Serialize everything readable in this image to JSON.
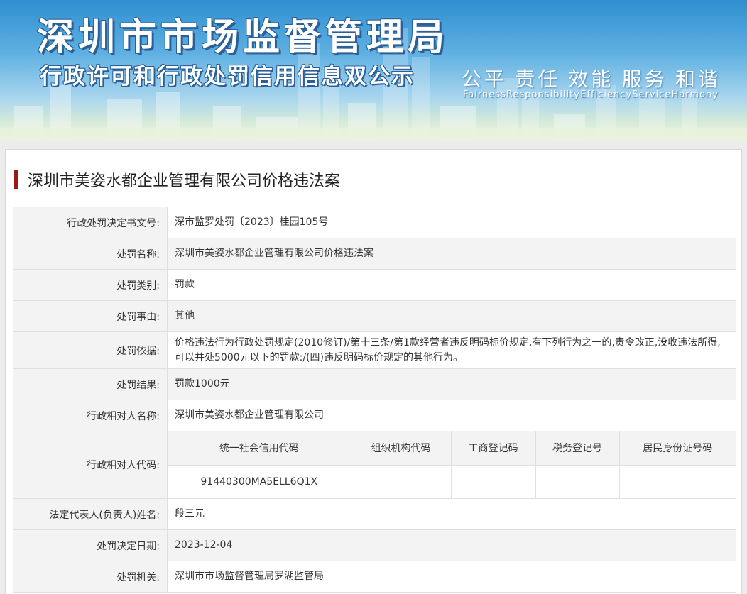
{
  "banner": {
    "title": "深圳市市场监督管理局",
    "subtitle": "行政许可和行政处罚信用信息双公示",
    "slogan": [
      "公平",
      "责任",
      "效能",
      "服务",
      "和谐"
    ],
    "slogan_en": [
      "Fairness",
      "Responsibility",
      "Efficiency",
      "Service",
      "Harmony"
    ]
  },
  "case_title": "深圳市美姿水都企业管理有限公司价格违法案",
  "rows": {
    "decision_no": {
      "label": "行政处罚决定书文号:",
      "value": "深市监罗处罚〔2023〕桂园105号"
    },
    "penalty_name": {
      "label": "处罚名称:",
      "value": "深圳市美姿水都企业管理有限公司价格违法案"
    },
    "penalty_type": {
      "label": "处罚类别:",
      "value": "罚款"
    },
    "penalty_reason": {
      "label": "处罚事由:",
      "value": "其他"
    },
    "penalty_basis": {
      "label": "处罚依据:",
      "value": "价格违法行为行政处罚规定(2010修订)/第十三条/第1款经营者违反明码标价规定,有下列行为之一的,责令改正,没收违法所得,可以并处5000元以下的罚款:/(四)违反明码标价规定的其他行为。"
    },
    "penalty_result": {
      "label": "处罚结果:",
      "value": "罚款1000元"
    },
    "party_name": {
      "label": "行政相对人名称:",
      "value": "深圳市美姿水都企业管理有限公司"
    },
    "party_code": {
      "label": "行政相对人代码:",
      "headers": [
        "统一社会信用代码",
        "组织机构代码",
        "工商登记码",
        "税务登记号",
        "居民身份证号码"
      ],
      "values": [
        "91440300MA5ELL6Q1X",
        "",
        "",
        "",
        ""
      ]
    },
    "legal_rep": {
      "label": "法定代表人(负责人)姓名:",
      "value": "段三元"
    },
    "decision_date": {
      "label": "处罚决定日期:",
      "value": "2023-12-04"
    },
    "authority": {
      "label": "处罚机关:",
      "value": "深圳市市场监督管理局罗湖监管局"
    }
  },
  "colors": {
    "accent": "#a0171b",
    "banner_blue": "#2f8fd0",
    "label_bg": "#f3f3f3",
    "border": "#e0e0e0"
  }
}
